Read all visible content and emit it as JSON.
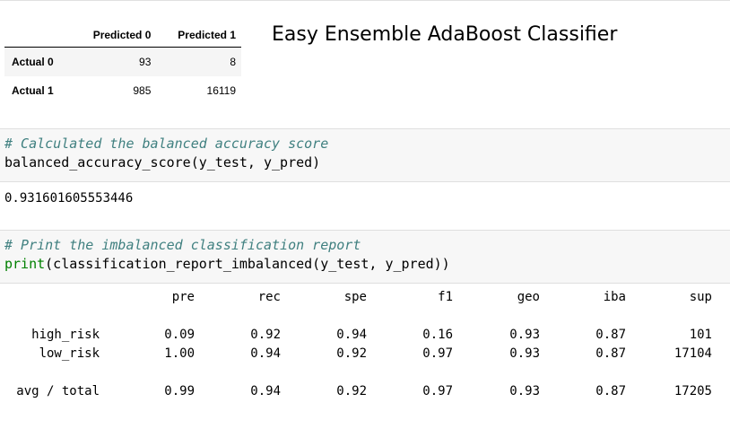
{
  "confusion_matrix": {
    "columns": [
      "Predicted 0",
      "Predicted 1"
    ],
    "rows": [
      {
        "label": "Actual 0",
        "values": [
          "93",
          "8"
        ]
      },
      {
        "label": "Actual 1",
        "values": [
          "985",
          "16119"
        ]
      }
    ]
  },
  "title": "Easy Ensemble AdaBoost Classifier",
  "cell1": {
    "comment": "# Calculated the balanced accuracy score",
    "code": "balanced_accuracy_score(y_test, y_pred)",
    "output": "0.931601605553446"
  },
  "cell2": {
    "comment": "# Print the imbalanced classification report",
    "code_fn": "print",
    "code_rest": "(classification_report_imbalanced(y_test, y_pred))"
  },
  "report": {
    "headers": [
      "pre",
      "rec",
      "spe",
      "f1",
      "geo",
      "iba",
      "sup"
    ],
    "rows": [
      {
        "label": "high_risk",
        "values": [
          "0.09",
          "0.92",
          "0.94",
          "0.16",
          "0.93",
          "0.87",
          "101"
        ]
      },
      {
        "label": "low_risk",
        "values": [
          "1.00",
          "0.94",
          "0.92",
          "0.97",
          "0.93",
          "0.87",
          "17104"
        ]
      }
    ],
    "total": {
      "label": "avg / total",
      "values": [
        "0.99",
        "0.94",
        "0.92",
        "0.97",
        "0.93",
        "0.87",
        "17205"
      ]
    }
  }
}
